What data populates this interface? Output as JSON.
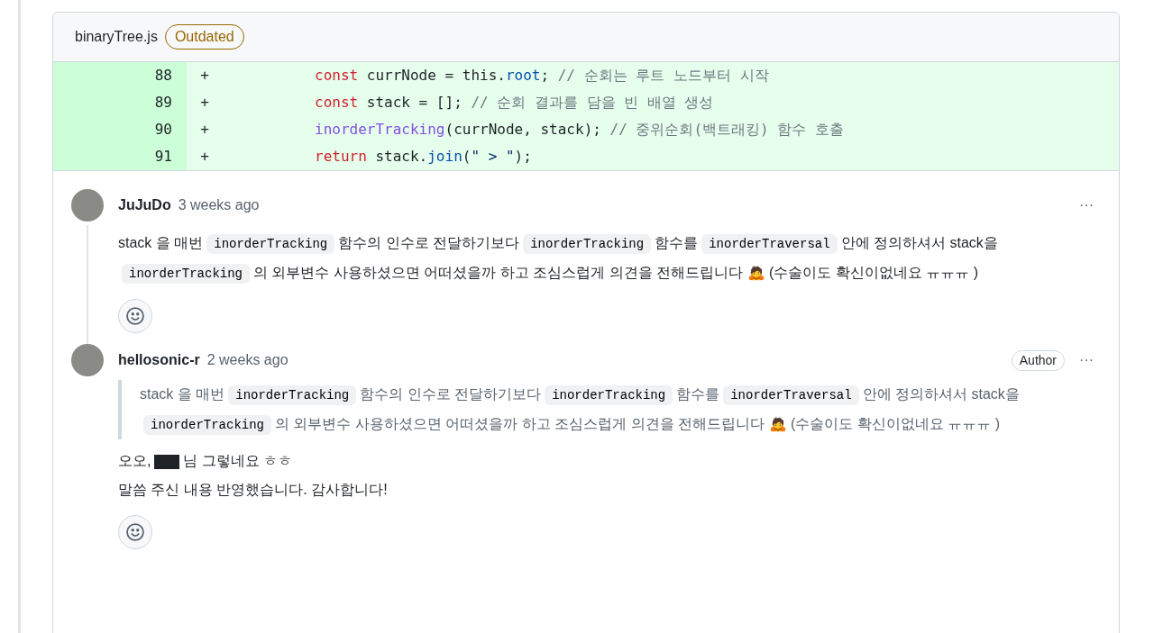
{
  "file": {
    "name": "binaryTree.js",
    "badge": "Outdated"
  },
  "lines": [
    {
      "number": "88",
      "sign": "+",
      "tokens": [
        {
          "kind": "keyword",
          "text": "const"
        },
        {
          "kind": "plain",
          "text": " currNode = this."
        },
        {
          "kind": "property",
          "text": "root"
        },
        {
          "kind": "plain",
          "text": "; "
        },
        {
          "kind": "comment",
          "text": "// 순회는 루트 노드부터 시작"
        }
      ]
    },
    {
      "number": "89",
      "sign": "+",
      "tokens": [
        {
          "kind": "keyword",
          "text": "const"
        },
        {
          "kind": "plain",
          "text": " stack = []; "
        },
        {
          "kind": "comment",
          "text": "// 순회 결과를 담을 빈 배열 생성"
        }
      ]
    },
    {
      "number": "90",
      "sign": "+",
      "tokens": [
        {
          "kind": "function",
          "text": "inorderTracking"
        },
        {
          "kind": "plain",
          "text": "(currNode, stack); "
        },
        {
          "kind": "comment",
          "text": "// 중위순회(백트래킹) 함수 호출"
        }
      ]
    },
    {
      "number": "91",
      "sign": "+",
      "tokens": [
        {
          "kind": "keyword",
          "text": "return"
        },
        {
          "kind": "plain",
          "text": " stack."
        },
        {
          "kind": "property",
          "text": "join"
        },
        {
          "kind": "plain",
          "text": "("
        },
        {
          "kind": "string",
          "text": "\" > \""
        },
        {
          "kind": "plain",
          "text": ");"
        }
      ]
    }
  ],
  "comments": [
    {
      "author": "JuJuDo",
      "time": "3 weeks ago",
      "more": "···",
      "thread_line": true,
      "body": [
        [
          {
            "kind": "text",
            "text": "stack 을 매번"
          },
          {
            "kind": "code",
            "text": "inorderTracking"
          },
          {
            "kind": "text",
            "text": "함수의 인수로 전달하기보다"
          },
          {
            "kind": "code",
            "text": "inorderTracking"
          },
          {
            "kind": "text",
            "text": "함수를"
          },
          {
            "kind": "code",
            "text": "inorderTraversal"
          },
          {
            "kind": "text",
            "text": "안에 정의하셔서 stack을"
          },
          {
            "kind": "code",
            "text": "inorderTracking"
          },
          {
            "kind": "text",
            "text": "의 외부변수 사용하셨으면 어떠셨을까 하고 조심스럽게 의견을 전해드립니다 🙇 (수술이도 확신이없네요 ㅠㅠㅠ )"
          }
        ]
      ]
    },
    {
      "author": "hellosonic-r",
      "time": "2 weeks ago",
      "badge": "Author",
      "more": "···",
      "thread_line": false,
      "quote": [
        {
          "kind": "text",
          "text": "stack 을 매번"
        },
        {
          "kind": "code",
          "text": "inorderTracking"
        },
        {
          "kind": "text",
          "text": "함수의 인수로 전달하기보다"
        },
        {
          "kind": "code",
          "text": "inorderTracking"
        },
        {
          "kind": "text",
          "text": "함수를"
        },
        {
          "kind": "code",
          "text": "inorderTraversal"
        },
        {
          "kind": "text",
          "text": "안에 정의하셔서 stack을"
        },
        {
          "kind": "code",
          "text": "inorderTracking"
        },
        {
          "kind": "text",
          "text": "의 외부변수 사용하셨으면 어떠셨을까 하고 조심스럽게 의견을 전해드립니다 🙇 (수술이도 확신이없네요 ㅠㅠㅠ )"
        }
      ],
      "body": [
        [
          {
            "kind": "text",
            "text": "오오,"
          },
          {
            "kind": "redacted"
          },
          {
            "kind": "text",
            "text": "님 그렇네요 ㅎㅎ"
          }
        ],
        [
          {
            "kind": "text",
            "text": "말씀 주신 내용 반영했습니다. 감사합니다!"
          }
        ]
      ]
    }
  ]
}
